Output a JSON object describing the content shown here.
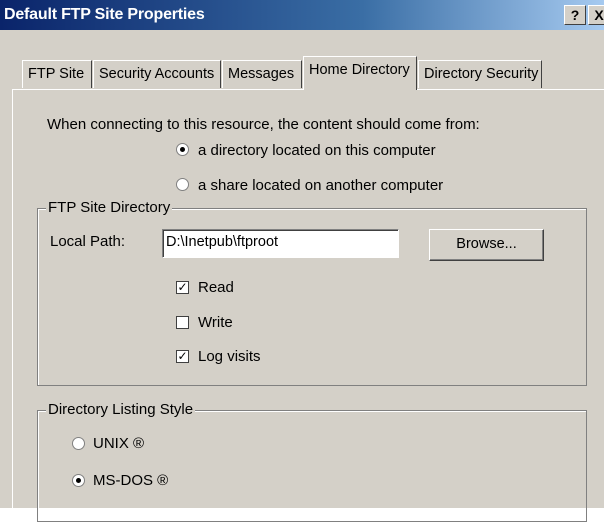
{
  "window": {
    "title": "Default FTP Site Properties",
    "help_label": "?",
    "close_label": "X"
  },
  "tabs": [
    {
      "label": "FTP Site",
      "active": false
    },
    {
      "label": "Security Accounts",
      "active": false
    },
    {
      "label": "Messages",
      "active": false
    },
    {
      "label": "Home Directory",
      "active": true
    },
    {
      "label": "Directory Security",
      "active": false
    }
  ],
  "home_directory": {
    "prompt": "When connecting to this resource, the content should come from:",
    "source_options": [
      {
        "label": "a directory located on this computer",
        "selected": true
      },
      {
        "label": "a share located on another computer",
        "selected": false
      }
    ],
    "ftp_site_directory": {
      "legend": "FTP Site Directory",
      "local_path_label": "Local Path:",
      "local_path_value": "D:\\Inetpub\\ftproot",
      "browse_label": "Browse...",
      "permissions": [
        {
          "label": "Read",
          "checked": true
        },
        {
          "label": "Write",
          "checked": false
        },
        {
          "label": "Log visits",
          "checked": true
        }
      ]
    },
    "listing_style": {
      "legend": "Directory Listing Style",
      "options": [
        {
          "label": "UNIX ®",
          "selected": false
        },
        {
          "label": "MS-DOS ®",
          "selected": true
        }
      ]
    }
  },
  "colors": {
    "title_bar_start": "#0a246a",
    "title_bar_end": "#a6caf0",
    "face": "#d4d0c8"
  }
}
